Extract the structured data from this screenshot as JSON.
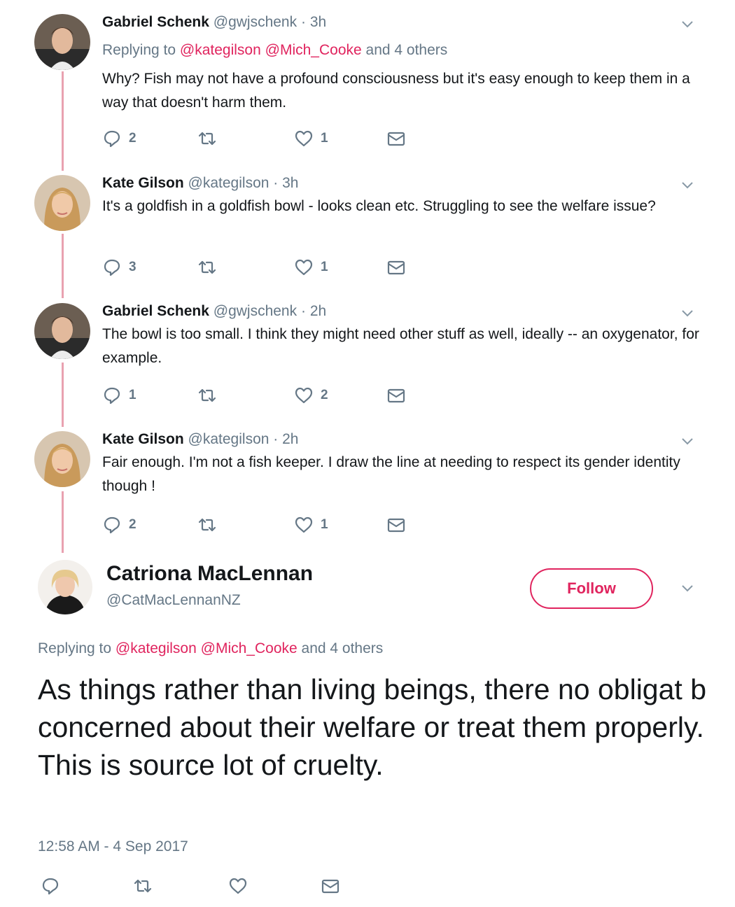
{
  "thread": [
    {
      "name": "Gabriel Schenk",
      "handle": "@gwjschenk",
      "time": "3h",
      "replying_prefix": "Replying to",
      "replying_mention_1": "@kategilson",
      "replying_mention_2": "@Mich_Cooke",
      "replying_suffix": "and 4 others",
      "text": "Why? Fish may not have a profound consciousness but it's easy enough to keep them in a way that doesn't harm them.",
      "replies": "2",
      "likes": "1"
    },
    {
      "name": "Kate Gilson",
      "handle": "@kategilson",
      "time": "3h",
      "text": "It's a goldfish in a goldfish bowl - looks clean etc. Struggling to see the welfare issue?",
      "replies": "3",
      "likes": "1"
    },
    {
      "name": "Gabriel Schenk",
      "handle": "@gwjschenk",
      "time": "2h",
      "text": "The bowl is too small. I think they might need other stuff as well, ideally -- an oxygenator, for example.",
      "replies": "1",
      "likes": "2"
    },
    {
      "name": "Kate Gilson",
      "handle": "@kategilson",
      "time": "2h",
      "text": "Fair enough. I'm not a fish keeper. I draw the line at needing to respect its gender identity though !",
      "replies": "2",
      "likes": "1"
    }
  ],
  "main": {
    "name": "Catriona MacLennan",
    "handle": "@CatMacLennanNZ",
    "follow_label": "Follow",
    "replying_prefix": "Replying to",
    "replying_mention_1": "@kategilson",
    "replying_mention_2": "@Mich_Cooke",
    "replying_suffix": "and 4 others",
    "text": "As things rather than living beings, there no obligat b concerned about their welfare or treat them properly. This is source lot of cruelty.",
    "timestamp": "12:58 AM - 4 Sep 2017"
  },
  "colors": {
    "accent": "#e0245e",
    "thread_line": "#e9a1b0",
    "muted": "#657786",
    "text": "#14171a"
  },
  "icons": [
    "reply-icon",
    "retweet-icon",
    "like-icon",
    "message-icon",
    "chevron-down-icon"
  ]
}
